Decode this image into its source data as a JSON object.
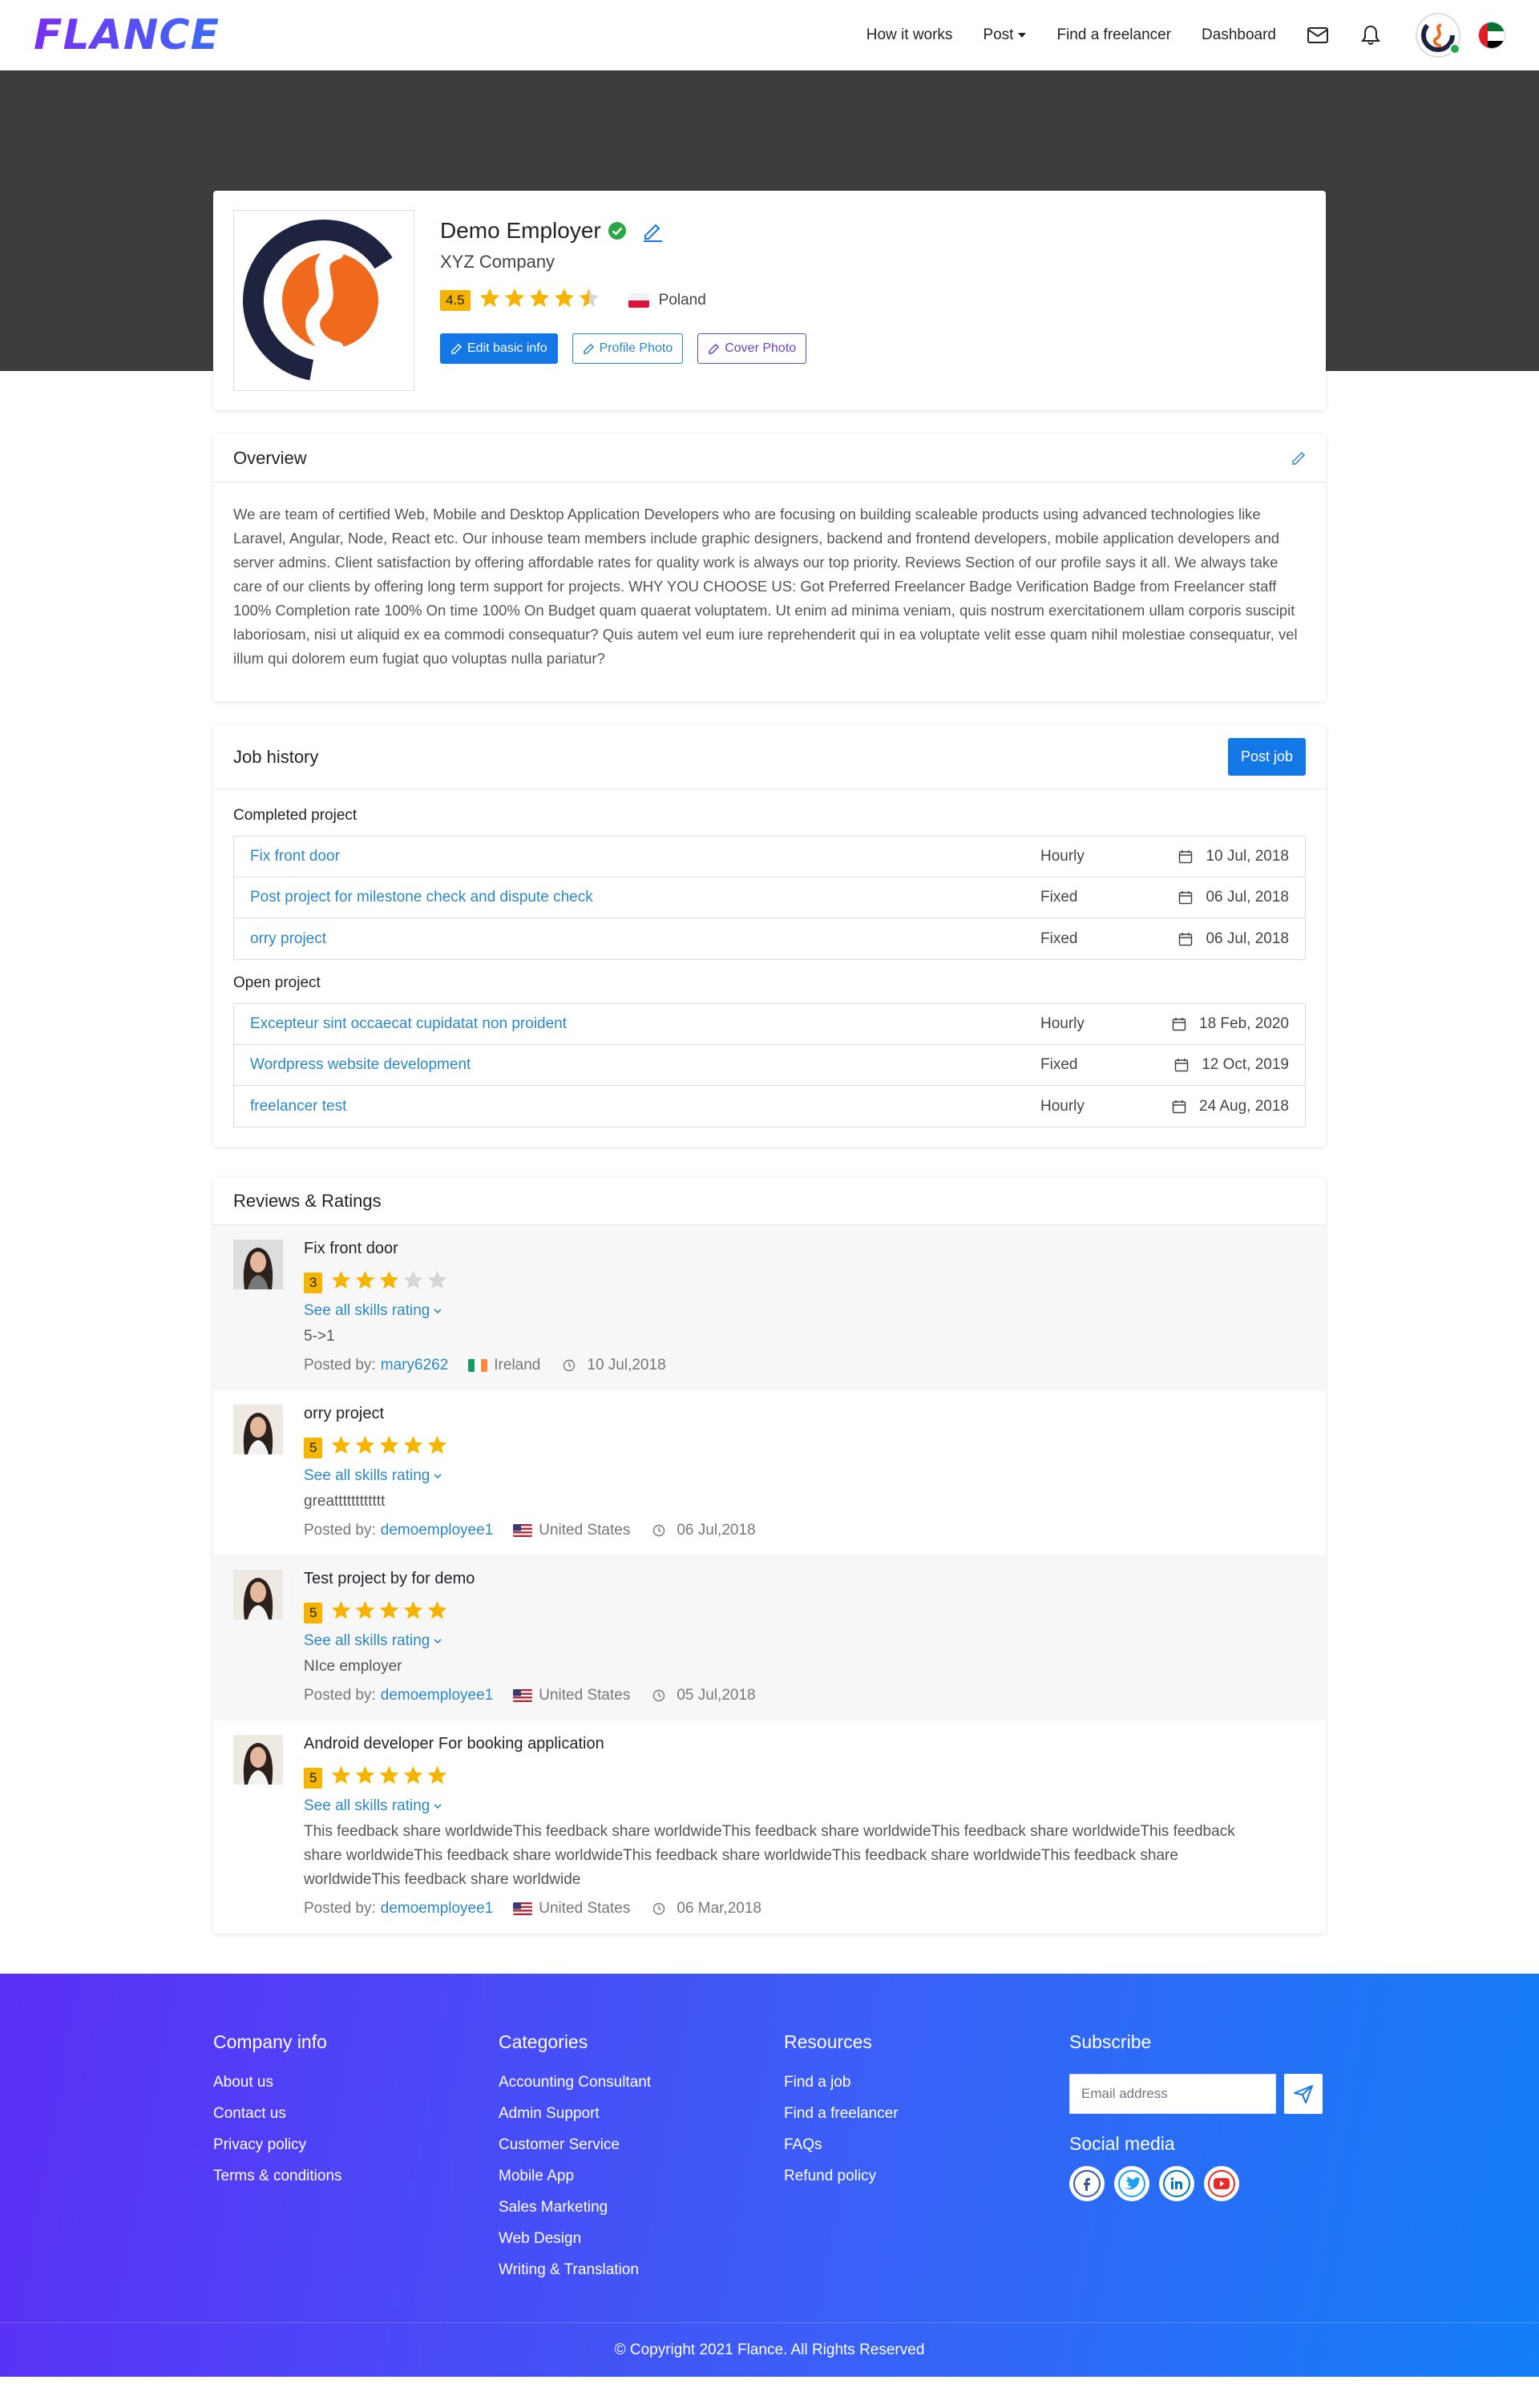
{
  "header": {
    "logo_text": "FLANCE",
    "nav": [
      {
        "label": "How it works"
      },
      {
        "label": "Post"
      },
      {
        "label": "Find a freelancer"
      },
      {
        "label": "Dashboard"
      }
    ]
  },
  "profile": {
    "name": "Demo Employer",
    "company": "XYZ Company",
    "rating": "4.5",
    "rating_value": 4.5,
    "country": "Poland",
    "buttons": {
      "edit_basic_info": "Edit basic info",
      "profile_photo": "Profile Photo",
      "cover_photo": "Cover Photo"
    }
  },
  "overview": {
    "title": "Overview",
    "text": "We are team of certified Web, Mobile and Desktop Application Developers who are focusing on building scaleable products using advanced technologies like Laravel, Angular, Node, React etc. Our inhouse team members include graphic designers, backend and frontend developers, mobile application developers and server admins. Client satisfaction by offering affordable rates for quality work is always our top priority. Reviews Section of our profile says it all. We always take care of our clients by offering long term support for projects. WHY YOU CHOOSE US: Got Preferred Freelancer Badge Verification Badge from Freelancer staff 100% Completion rate 100% On time 100% On Budget quam quaerat voluptatem. Ut enim ad minima veniam, quis nostrum exercitationem ullam corporis suscipit laboriosam, nisi ut aliquid ex ea commodi consequatur? Quis autem vel eum iure reprehenderit qui in ea voluptate velit esse quam nihil molestiae consequatur, vel illum qui dolorem eum fugiat quo voluptas nulla pariatur?"
  },
  "job_history": {
    "title": "Job history",
    "post_job": "Post job",
    "completed_title": "Completed project",
    "completed": [
      {
        "title": "Fix front door",
        "type": "Hourly",
        "date": "10 Jul, 2018"
      },
      {
        "title": "Post project for milestone check and dispute check",
        "type": "Fixed",
        "date": "06 Jul, 2018"
      },
      {
        "title": "orry project",
        "type": "Fixed",
        "date": "06 Jul, 2018"
      }
    ],
    "open_title": "Open project",
    "open": [
      {
        "title": "Excepteur sint occaecat cupidatat non proident",
        "type": "Hourly",
        "date": "18 Feb, 2020"
      },
      {
        "title": "Wordpress website development",
        "type": "Fixed",
        "date": "12 Oct, 2019"
      },
      {
        "title": "freelancer test",
        "type": "Hourly",
        "date": "24 Aug, 2018"
      }
    ]
  },
  "reviews": {
    "title": "Reviews & Ratings",
    "see_all": "See all skills rating",
    "posted_by": "Posted by:",
    "items": [
      {
        "title": "Fix front door",
        "rating": "3",
        "stars": 3,
        "text": "5->1",
        "user": "mary6262",
        "country": "Ireland",
        "date": "10 Jul,2018"
      },
      {
        "title": "orry project",
        "rating": "5",
        "stars": 5,
        "text": "greatttttttttttt",
        "user": "demoemployee1",
        "country": "United States",
        "date": "06 Jul,2018"
      },
      {
        "title": "Test project by for demo",
        "rating": "5",
        "stars": 5,
        "text": "NIce employer",
        "user": "demoemployee1",
        "country": "United States",
        "date": "05 Jul,2018"
      },
      {
        "title": "Android developer For booking application",
        "rating": "5",
        "stars": 5,
        "text": "This feedback share worldwideThis feedback share worldwideThis feedback share worldwideThis feedback share worldwideThis feedback share worldwideThis feedback share worldwideThis feedback share worldwideThis feedback share worldwideThis feedback share worldwideThis feedback share worldwide",
        "user": "demoemployee1",
        "country": "United States",
        "date": "06 Mar,2018"
      }
    ]
  },
  "footer": {
    "company_title": "Company info",
    "company_links": [
      "About us",
      "Contact us",
      "Privacy policy",
      "Terms & conditions"
    ],
    "categories_title": "Categories",
    "categories_links": [
      "Accounting Consultant",
      "Admin Support",
      "Customer Service",
      "Mobile App",
      "Sales Marketing",
      "Web Design",
      "Writing & Translation"
    ],
    "resources_title": "Resources",
    "resources_links": [
      "Find a job",
      "Find a freelancer",
      "FAQs",
      "Refund policy"
    ],
    "subscribe_title": "Subscribe",
    "email_placeholder": "Email address",
    "social_title": "Social media",
    "copyright": "© Copyright 2021 Flance. All Rights Reserved"
  },
  "colors": {
    "primary": "#1378e6",
    "link": "#2b88c6",
    "star": "#f5b400",
    "banner": "#3d3d3d",
    "footer_start": "#5b2ff5",
    "footer_end": "#127ef5"
  }
}
